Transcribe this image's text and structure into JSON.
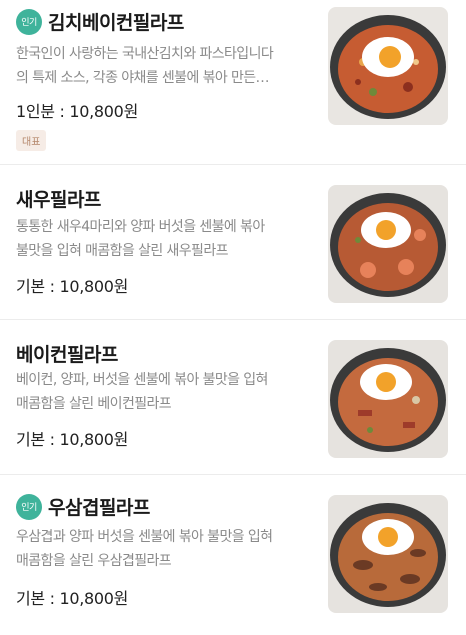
{
  "menu": {
    "items": [
      {
        "badge": "인기",
        "title": "김치베이컨필라프",
        "desc_line1": "한국인이 사랑하는 국내산김치와 파스타입니다",
        "desc_line2": "의 특제 소스, 각종 야채를 센불에 볶아 만든…",
        "price": "1인분 : 10,800원",
        "tag": "대표",
        "image_icon": "kimchi-bacon-pilaf-photo"
      },
      {
        "title": "새우필라프",
        "desc_line1": "통통한 새우4마리와 양파 버섯을 센불에 볶아",
        "desc_line2": "불맛을 입혀 매콤함을 살린 새우필라프",
        "price": "기본 : 10,800원",
        "image_icon": "shrimp-pilaf-photo"
      },
      {
        "title": "베이컨필라프",
        "desc_line1": "베이컨, 양파, 버섯을 센불에 볶아 불맛을 입혀",
        "desc_line2": "매콤함을 살린 베이컨필라프",
        "price": "기본 : 10,800원",
        "image_icon": "bacon-pilaf-photo"
      },
      {
        "badge": "인기",
        "title": "우삼겹필라프",
        "desc_line1": "우삼겹과 양파 버섯을 센불에 볶아 불맛을 입혀",
        "desc_line2": "매콤함을 살린 우삼겹필라프",
        "price": "기본 : 10,800원",
        "image_icon": "beef-brisket-pilaf-photo"
      }
    ]
  },
  "colors": {
    "badge": "#3fb39b",
    "tag_bg": "#f6ece6",
    "tag_text": "#b5876b"
  }
}
